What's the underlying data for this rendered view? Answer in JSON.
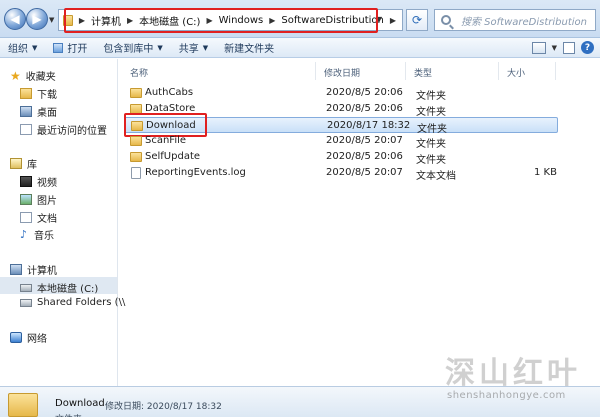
{
  "address": {
    "crumbs": [
      "计算机",
      "本地磁盘 (C:)",
      "Windows",
      "SoftwareDistribution"
    ],
    "search_placeholder": "搜索 SoftwareDistribution"
  },
  "toolbar": {
    "organize": "组织",
    "open": "打开",
    "include_in_library": "包含到库中",
    "share": "共享",
    "new_folder": "新建文件夹"
  },
  "sidebar": {
    "favorites": "收藏夹",
    "downloads": "下载",
    "desktop": "桌面",
    "recent": "最近访问的位置",
    "libraries": "库",
    "videos": "视频",
    "pictures": "图片",
    "documents": "文档",
    "music": "音乐",
    "computer": "计算机",
    "local_disk": "本地磁盘 (C:)",
    "shared_folders": "Shared Folders (\\\\",
    "network": "网络"
  },
  "columns": {
    "name": "名称",
    "date": "修改日期",
    "type": "类型",
    "size": "大小"
  },
  "files": [
    {
      "name": "AuthCabs",
      "date": "2020/8/5 20:06",
      "type": "文件夹",
      "size": ""
    },
    {
      "name": "DataStore",
      "date": "2020/8/5 20:06",
      "type": "文件夹",
      "size": ""
    },
    {
      "name": "Download",
      "date": "2020/8/17 18:32",
      "type": "文件夹",
      "size": ""
    },
    {
      "name": "ScanFile",
      "date": "2020/8/5 20:07",
      "type": "文件夹",
      "size": ""
    },
    {
      "name": "SelfUpdate",
      "date": "2020/8/5 20:06",
      "type": "文件夹",
      "size": ""
    },
    {
      "name": "ReportingEvents.log",
      "date": "2020/8/5 20:07",
      "type": "文本文档",
      "size": "1 KB"
    }
  ],
  "details": {
    "name": "Download",
    "meta": "修改日期: 2020/8/17 18:32",
    "type": "文件夹"
  },
  "watermark": {
    "text": "深山红叶",
    "url": "shenshanhongye.com"
  },
  "colors": {
    "highlight_outline": "#e02020",
    "selection": "#c9e0f8",
    "accent": "#2f6fc1"
  }
}
